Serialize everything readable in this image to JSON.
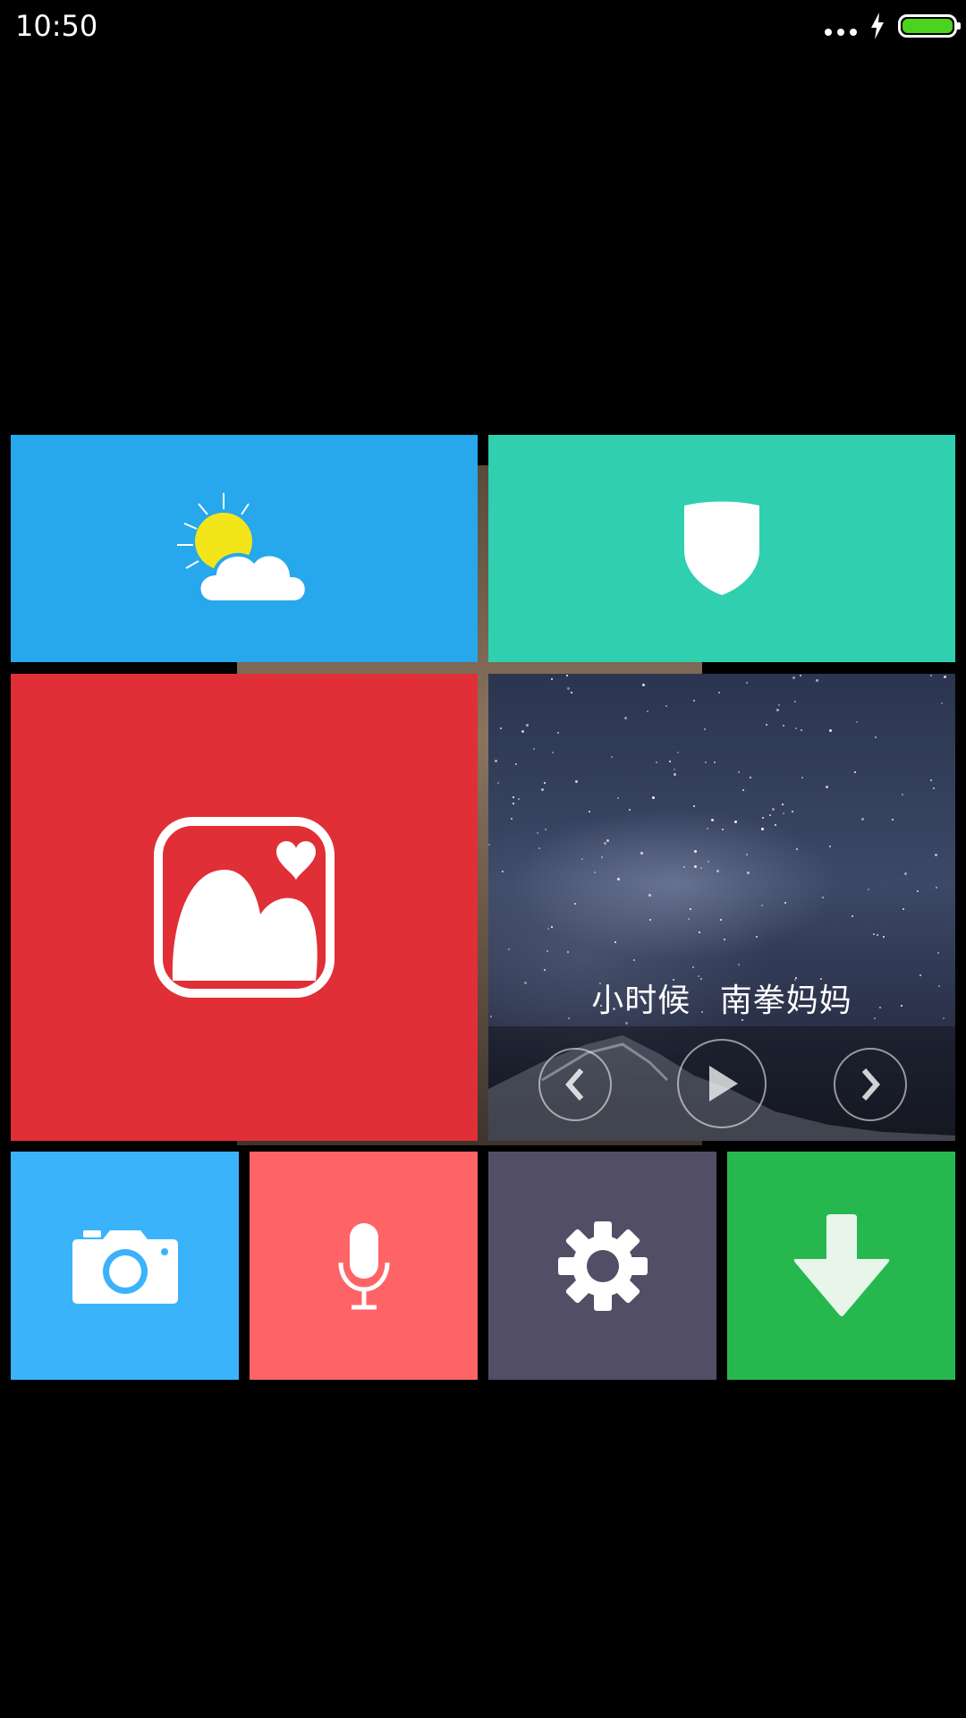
{
  "status_bar": {
    "time": "10:50",
    "icons": [
      "more-dots-icon",
      "charging-icon",
      "battery-icon"
    ],
    "battery_color": "#4dd21e"
  },
  "tiles": {
    "weather": {
      "icon": "weather-sun-cloud-icon",
      "color": "#27a7ec"
    },
    "security": {
      "icon": "shield-icon",
      "color": "#2fcfb0"
    },
    "gallery": {
      "icon": "gallery-heart-icon",
      "color": "#e02f36"
    },
    "music": {
      "song": "小时候",
      "artist": "南拳妈妈",
      "controls": [
        "previous-icon",
        "play-icon",
        "next-icon"
      ]
    },
    "camera": {
      "icon": "camera-icon",
      "color": "#3bb3fa"
    },
    "microphone": {
      "icon": "microphone-icon",
      "color": "#fe6466"
    },
    "settings": {
      "icon": "gear-icon",
      "color": "#514e66"
    },
    "download": {
      "icon": "download-arrow-icon",
      "color": "#27b74f"
    }
  }
}
